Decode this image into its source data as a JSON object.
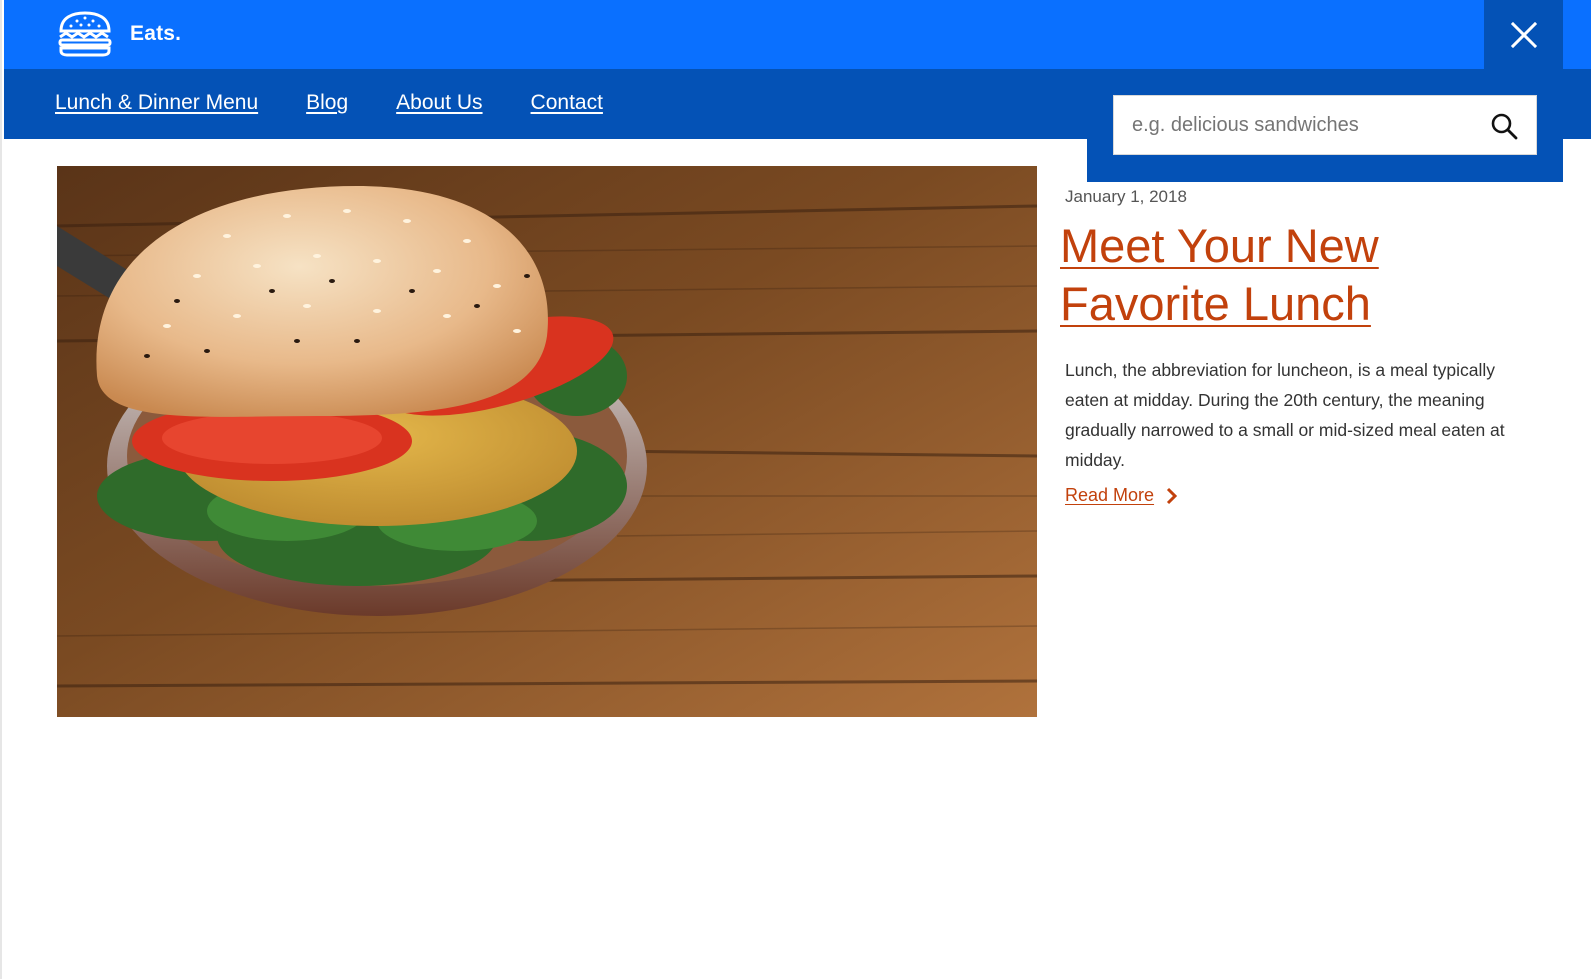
{
  "header": {
    "brand": "Eats.",
    "logo_icon": "burger-icon",
    "close_icon": "close-icon",
    "colors": {
      "top_bar": "#0a70ff",
      "nav_bar": "#0452b6",
      "accent": "#c2410c"
    }
  },
  "nav": {
    "items": [
      {
        "label": "Lunch & Dinner Menu"
      },
      {
        "label": "Blog"
      },
      {
        "label": "About Us"
      },
      {
        "label": "Contact"
      }
    ]
  },
  "search": {
    "placeholder": "e.g. delicious sandwiches",
    "value": "",
    "icon": "search-icon"
  },
  "article": {
    "date": "January 1, 2018",
    "title": "Meet Your New Favorite Lunch",
    "excerpt": "Lunch, the abbreviation for luncheon, is a meal typically eaten at midday. During the 20th century, the meaning gradually narrowed to a small or mid-sized meal eaten at midday.",
    "read_more": "Read More",
    "read_more_icon": "chevron-right-icon"
  }
}
